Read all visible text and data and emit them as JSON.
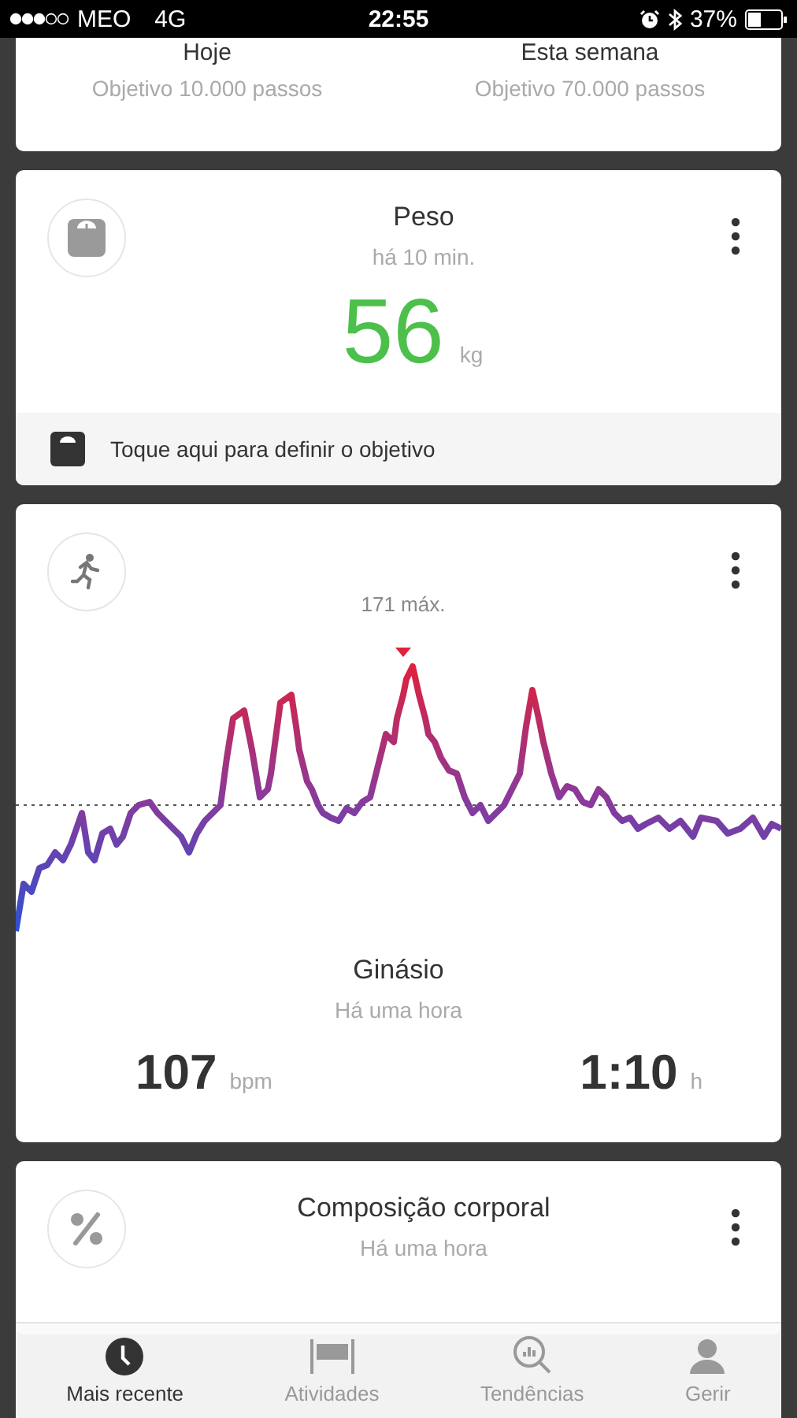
{
  "status_bar": {
    "carrier": "MEO",
    "network": "4G",
    "time": "22:55",
    "battery": "37%"
  },
  "steps_card": {
    "columns": [
      {
        "title": "Hoje",
        "goal": "Objetivo 10.000 passos"
      },
      {
        "title": "Esta semana",
        "goal": "Objetivo 70.000 passos"
      }
    ]
  },
  "weight_card": {
    "title": "Peso",
    "time": "há 10 min.",
    "value": "56",
    "unit": "kg",
    "goal_prompt": "Toque aqui para definir o objetivo"
  },
  "activity_card": {
    "max_label": "171 máx.",
    "title": "Ginásio",
    "time": "Há uma hora",
    "heart_rate": "107",
    "heart_rate_unit": "bpm",
    "duration": "1:10",
    "duration_unit": "h"
  },
  "body_card": {
    "title": "Composição corporal",
    "time": "Há uma hora"
  },
  "tabs": [
    {
      "label": "Mais recente",
      "selected": true
    },
    {
      "label": "Atividades",
      "selected": false
    },
    {
      "label": "Tendências",
      "selected": false
    },
    {
      "label": "Gerir",
      "selected": false
    }
  ]
}
